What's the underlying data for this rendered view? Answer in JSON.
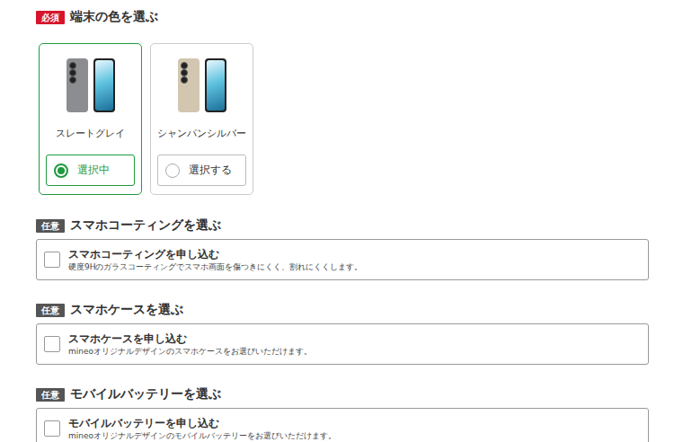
{
  "color_section": {
    "badge": "必須",
    "title": "端末の色を選ぶ"
  },
  "colors": [
    {
      "name": "スレートグレイ",
      "button": "選択中",
      "selected": true,
      "color": "#8b8d90"
    },
    {
      "name": "シャンパンシルバー",
      "button": "選択する",
      "selected": false,
      "color": "#d2c6b0"
    }
  ],
  "options": [
    {
      "badge": "任意",
      "title": "スマホコーティングを選ぶ",
      "label": "スマホコーティングを申し込む",
      "description": "硬度9Hのガラスコーティングでスマホ画面を傷つきにくく、割れにくくします。",
      "checked": false
    },
    {
      "badge": "任意",
      "title": "スマホケースを選ぶ",
      "label": "スマホケースを申し込む",
      "description": "mineoオリジナルデザインのスマホケースをお選びいただけます。",
      "checked": false
    },
    {
      "badge": "任意",
      "title": "モバイルバッテリーを選ぶ",
      "label": "モバイルバッテリーを申し込む",
      "description": "mineoオリジナルデザインのモバイルバッテリーをお選びいただけます。",
      "checked": false
    }
  ]
}
